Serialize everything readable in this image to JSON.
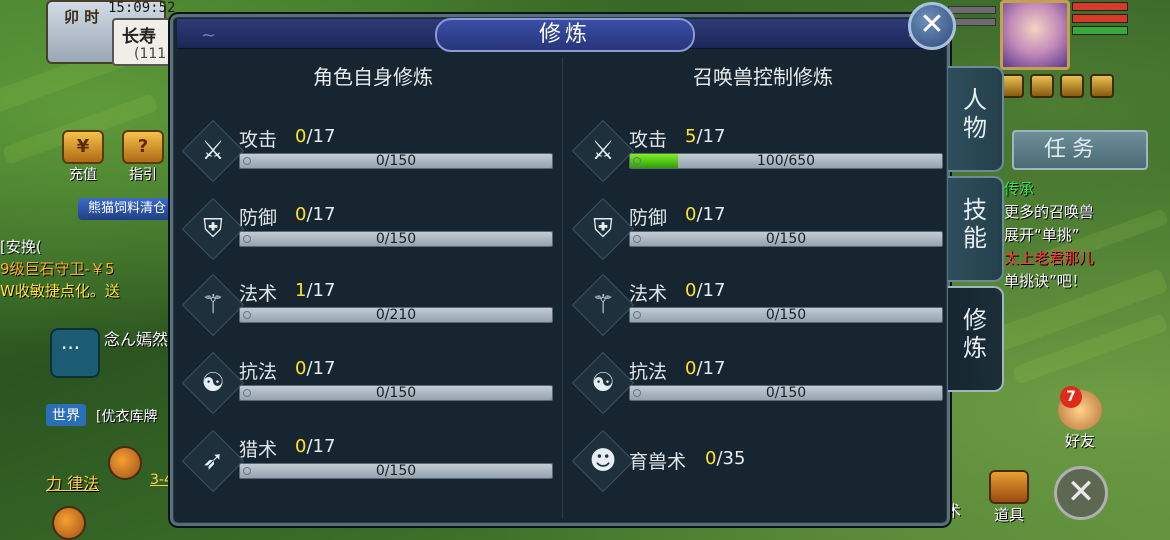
{
  "hud": {
    "shichen": "卯 时",
    "clock": "15:09:52",
    "location_name": "长寿",
    "location_coord": "(111",
    "recharge_label": "充值",
    "guide_label": "指引",
    "banner": "熊猫饲料清仓",
    "chat_line1": "[安挽(",
    "chat_line2": "9级巨石守卫-￥5",
    "chat_line3": "W收敏捷点化。送",
    "chat_name": "念ん嫣然",
    "world_tag": "世界",
    "world_msg": "[优衣库牌",
    "link_name": "力 律法",
    "link_name2": "3-4"
  },
  "right_hud": {
    "task_label": "任务",
    "task_lines": [
      "传承",
      "更多的召唤兽",
      "展开“单挑”",
      "太上老君那儿",
      "单挑诀”吧！"
    ],
    "friend_badge": "7",
    "friend_label": "好友",
    "item_label": "道具",
    "skill_label": "术",
    "close_icon": "✕"
  },
  "panel": {
    "title": "修炼",
    "close_glyph": "✕",
    "left_title": "角色自身修炼",
    "right_title": "召唤兽控制修炼",
    "left_rows": [
      {
        "name": "攻击",
        "cur": "0",
        "max": "/17",
        "bar": "0/150",
        "fill": 0,
        "icon": "sword-icon",
        "glyph": "⚔"
      },
      {
        "name": "防御",
        "cur": "0",
        "max": "/17",
        "bar": "0/150",
        "fill": 0,
        "icon": "shield-icon",
        "glyph": "⛨"
      },
      {
        "name": "法术",
        "cur": "1",
        "max": "/17",
        "bar": "0/210",
        "fill": 0,
        "icon": "magic-staff-icon",
        "glyph": "⚚"
      },
      {
        "name": "抗法",
        "cur": "0",
        "max": "/17",
        "bar": "0/150",
        "fill": 0,
        "icon": "yin-yang-icon",
        "glyph": "☯"
      },
      {
        "name": "猎术",
        "cur": "0",
        "max": "/17",
        "bar": "0/150",
        "fill": 0,
        "icon": "bow-icon",
        "glyph": "➶"
      }
    ],
    "right_rows": [
      {
        "name": "攻击",
        "cur": "5",
        "max": "/17",
        "bar": "100/650",
        "fill": 0.1538,
        "icon": "sword-icon",
        "glyph": "⚔"
      },
      {
        "name": "防御",
        "cur": "0",
        "max": "/17",
        "bar": "0/150",
        "fill": 0,
        "icon": "shield-icon",
        "glyph": "⛨"
      },
      {
        "name": "法术",
        "cur": "0",
        "max": "/17",
        "bar": "0/150",
        "fill": 0,
        "icon": "magic-staff-icon",
        "glyph": "⚚"
      },
      {
        "name": "抗法",
        "cur": "0",
        "max": "/17",
        "bar": "0/150",
        "fill": 0,
        "icon": "yin-yang-icon",
        "glyph": "☯"
      },
      {
        "name": "育兽术",
        "cur": "0",
        "max": "/35",
        "icon": "beast-icon",
        "glyph": "☻"
      }
    ]
  },
  "tabs": [
    {
      "label_top": "人",
      "label_bottom": "物",
      "active": false
    },
    {
      "label_top": "技",
      "label_bottom": "能",
      "active": false
    },
    {
      "label_top": "修",
      "label_bottom": "炼",
      "active": true
    }
  ]
}
